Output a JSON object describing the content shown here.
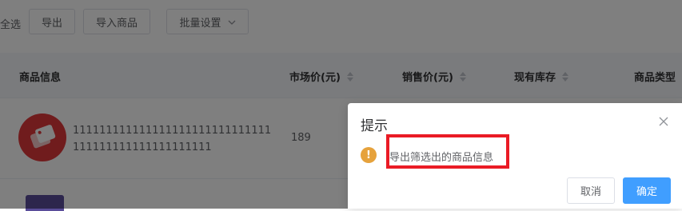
{
  "toolbar": {
    "select_all": "全选",
    "export": "导出",
    "import": "导入商品",
    "batch": "批量设置"
  },
  "table": {
    "headers": {
      "info": "商品信息",
      "market_price": "市场价(元)",
      "sale_price": "销售价(元)",
      "stock": "现有库存",
      "type": "商品类型"
    },
    "rows": [
      {
        "name": "111111111111111111111111111111111111111111111111111",
        "market_price": "189"
      }
    ]
  },
  "dialog": {
    "title": "提示",
    "message": "导出筛选出的商品信息",
    "cancel": "取消",
    "confirm": "确定",
    "warning_icon": "warning-icon",
    "highlight_color": "#ea1b25"
  },
  "colors": {
    "primary": "#409eff",
    "warning": "#e6a23c",
    "thumbnail": "#e1383a"
  }
}
